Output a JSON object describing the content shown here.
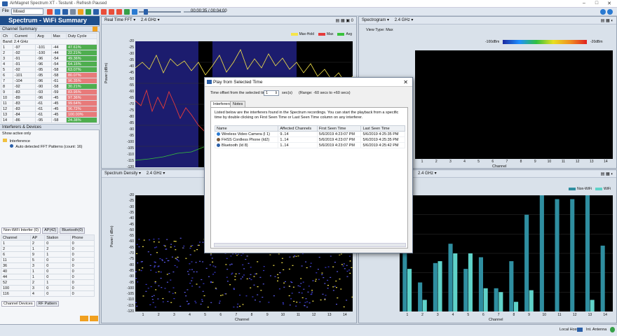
{
  "window": {
    "title": "AirMagnet Spectrum XT - Testunit - Refresh Paused"
  },
  "toolbar": {
    "mode_value": "Mixed",
    "time_readout": "00:00:35 / 00:04:00",
    "playback_fraction": 0.15
  },
  "left_panel": {
    "title": "Spectrum - WiFi Summary",
    "channel_summary_label": "Channel Summary",
    "columns": [
      "Ch",
      "Current",
      "Avg",
      "Max",
      "Duty Cycle"
    ],
    "band_label": "Band: 2.4 GHz",
    "rows": [
      [
        "1",
        "-97",
        "-101",
        "-44",
        "47.61%"
      ],
      [
        "2",
        "-92",
        "-100",
        "-44",
        "22.21%"
      ],
      [
        "3",
        "-91",
        "-96",
        "-54",
        "49.36%"
      ],
      [
        "4",
        "-91",
        "-96",
        "-54",
        "64.15%"
      ],
      [
        "5",
        "-92",
        "-95",
        "-58",
        "63.07%"
      ],
      [
        "6",
        "-101",
        "-95",
        "-58",
        "80.07%"
      ],
      [
        "7",
        "-104",
        "-96",
        "-61",
        "96.35%"
      ],
      [
        "8",
        "-92",
        "-90",
        "-58",
        "30.21%"
      ],
      [
        "9",
        "-83",
        "-93",
        "-59",
        "83.95%"
      ],
      [
        "10",
        "-89",
        "-96",
        "-45",
        "97.36%"
      ],
      [
        "11",
        "-83",
        "-61",
        "-45",
        "99.64%"
      ],
      [
        "12",
        "-83",
        "-61",
        "-45",
        "96.72%"
      ],
      [
        "13",
        "-84",
        "-61",
        "-45",
        "100.00%"
      ],
      [
        "14",
        "-86",
        "-95",
        "-58",
        "24.38%"
      ]
    ],
    "interferers_label": "Interferers & Devices",
    "show_active_label": "Show active only",
    "tree_root": "Interference",
    "tree_child": "Auto detected FFT Patterns (count: 16)",
    "tabs": [
      "Non-WiFi Interfer (0)",
      "AP(42)",
      "Bluetooth(0)"
    ],
    "device_columns": [
      "Channel",
      "AP",
      "Station",
      "Phone"
    ],
    "device_rows": [
      [
        "1",
        "2",
        "0",
        "0"
      ],
      [
        "2",
        "1",
        "2",
        "0"
      ],
      [
        "6",
        "9",
        "1",
        "0"
      ],
      [
        "11",
        "5",
        "0",
        "0"
      ],
      [
        "36",
        "3",
        "0",
        "0"
      ],
      [
        "40",
        "1",
        "0",
        "0"
      ],
      [
        "44",
        "1",
        "0",
        "0"
      ],
      [
        "52",
        "2",
        "1",
        "0"
      ],
      [
        "100",
        "3",
        "0",
        "0"
      ],
      [
        "116",
        "4",
        "0",
        "0"
      ]
    ],
    "bottom_tabs": [
      "Channel Devices",
      "RF Pattern"
    ]
  },
  "panes": {
    "realtime": {
      "label": "Real Time FFT",
      "band": "2.4 GHz",
      "legend": [
        "Max-Hold",
        "Max",
        "Avg"
      ],
      "ylabel": "Power (dBm)",
      "yticks": [
        "-20",
        "-25",
        "-30",
        "-35",
        "-40",
        "-45",
        "-50",
        "-55",
        "-60",
        "-65",
        "-70",
        "-75",
        "-80",
        "-85",
        "-90",
        "-95",
        "-100",
        "-105",
        "-110",
        "-115",
        "-120"
      ]
    },
    "spectrogram": {
      "label": "Spectrogram",
      "band": "2.4 GHz",
      "view_type": "View Type: Max",
      "scale_low": "-100dBm",
      "scale_high": "-20dBm"
    },
    "density": {
      "label": "Spectrum Density",
      "band": "2.4 GHz",
      "ylabel": "Power ( dBm)",
      "yticks": [
        "-20",
        "-25",
        "-30",
        "-35",
        "-40",
        "-45",
        "-50",
        "-55",
        "-60",
        "-65",
        "-70",
        "-75",
        "-80",
        "-85",
        "-90",
        "-95",
        "-100",
        "-105",
        "-110",
        "-115",
        "-120"
      ]
    },
    "utilization": {
      "band": "2.4 GHz",
      "legend": [
        "Non-WiFi",
        "WiFi"
      ]
    },
    "xlabel": "Channel",
    "channels": [
      "1",
      "2",
      "3",
      "4",
      "5",
      "6",
      "7",
      "8",
      "9",
      "10",
      "11",
      "12",
      "13",
      "14"
    ]
  },
  "chart_data": {
    "type": "bar",
    "categories": [
      "1",
      "2",
      "3",
      "4",
      "5",
      "6",
      "7",
      "8",
      "9",
      "10",
      "11",
      "12",
      "13",
      "14"
    ],
    "series": [
      {
        "name": "Non-WiFi",
        "values": [
          35,
          15,
          25,
          35,
          22,
          28,
          12,
          26,
          50,
          60,
          58,
          58,
          60,
          34
        ]
      },
      {
        "name": "WiFi",
        "values": [
          22,
          6,
          26,
          30,
          30,
          12,
          10,
          5,
          11,
          0,
          0,
          0,
          6,
          0
        ]
      }
    ],
    "ylim": [
      0,
      60
    ],
    "xlabel": "Channel"
  },
  "dialog": {
    "title": "Play from Selected Time",
    "offset_label": "Time offset from the selected time",
    "offset_value": "1",
    "offset_unit": "sec(s)",
    "range_text": "(Range: -60 secs to +60 secs)",
    "tabs": [
      "Interferers",
      "Notes"
    ],
    "description": "Listed below are the interferers found in the Spectrum recordings. You can start the playback from a specific time by double clicking on First Seen Time or Last Seen Time column on any interferer.",
    "columns": [
      "Name",
      "Affected Channels",
      "First Seen Time",
      "Last Seen Time"
    ],
    "rows": [
      [
        "Wireless Video Camera (I 1)",
        "9..14",
        "5/6/2019 4:23:07 PM",
        "5/6/2019 4:25:35 PM"
      ],
      [
        "FHSS Cordless Phone (Id2)",
        "1..14",
        "5/6/2019 4:23:07 PM",
        "5/6/2019 4:25:35 PM"
      ],
      [
        "Bluetooth (Id 8)",
        "1..14",
        "5/6/2019 4:23:07 PM",
        "5/6/2019 4:25:42 PM"
      ]
    ]
  },
  "status": {
    "host": "Local Host",
    "antenna": "Int. Antenna"
  },
  "colors": {
    "accent": "#1f4e8c",
    "wifi": "#5fd3c9",
    "nonwifi": "#2f8ea0"
  }
}
